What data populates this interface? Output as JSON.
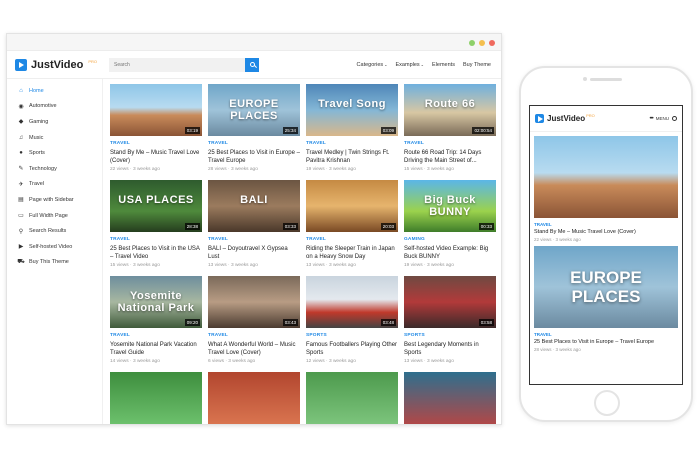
{
  "site": {
    "logo_text": "JustVideo",
    "logo_sup": "PRO",
    "search_placeholder": "Search"
  },
  "topnav": [
    {
      "label": "Categories",
      "caret": "⌄"
    },
    {
      "label": "Examples",
      "caret": "⌄"
    },
    {
      "label": "Elements",
      "caret": ""
    },
    {
      "label": "Buy Theme",
      "caret": ""
    }
  ],
  "sidebar": [
    {
      "label": "Home",
      "icon": "home-icon",
      "glyph": "⌂",
      "active": true
    },
    {
      "label": "Automotive",
      "icon": "car-icon",
      "glyph": "◉"
    },
    {
      "label": "Gaming",
      "icon": "gamepad-icon",
      "glyph": "◆"
    },
    {
      "label": "Music",
      "icon": "headphones-icon",
      "glyph": "♫"
    },
    {
      "label": "Sports",
      "icon": "ball-icon",
      "glyph": "●"
    },
    {
      "label": "Technology",
      "icon": "wrench-icon",
      "glyph": "✎"
    },
    {
      "label": "Travel",
      "icon": "plane-icon",
      "glyph": "✈"
    },
    {
      "label": "Page with Sidebar",
      "icon": "page-icon",
      "glyph": "▤"
    },
    {
      "label": "Full Width Page",
      "icon": "page-icon",
      "glyph": "▭"
    },
    {
      "label": "Search Results",
      "icon": "search-icon",
      "glyph": "⚲"
    },
    {
      "label": "Self-hosted Video",
      "icon": "video-icon",
      "glyph": "▶"
    },
    {
      "label": "Buy This Theme",
      "icon": "cart-icon",
      "glyph": "⛟"
    }
  ],
  "videos": [
    {
      "category": "TRAVEL",
      "title": "Stand By Me – Music Travel Love (Cover)",
      "views": "22 views",
      "age": "3 weeks ago",
      "duration": "03:19",
      "overlay": ""
    },
    {
      "category": "TRAVEL",
      "title": "25 Best Places to Visit in Europe – Travel Europe",
      "views": "28 views",
      "age": "3 weeks ago",
      "duration": "25:34",
      "overlay": "EUROPE PLACES"
    },
    {
      "category": "TRAVEL",
      "title": "Travel Medley | Twin Strings Ft. Pavitra Krishnan",
      "views": "19 views",
      "age": "3 weeks ago",
      "duration": "03:09",
      "overlay": "Travel Song"
    },
    {
      "category": "TRAVEL",
      "title": "Route 66 Road Trip: 14 Days Driving the Main Street of...",
      "views": "15 views",
      "age": "3 weeks ago",
      "duration": "02:00:54",
      "overlay": "Route 66"
    },
    {
      "category": "TRAVEL",
      "title": "25 Best Places to Visit in the USA – Travel Video",
      "views": "15 views",
      "age": "3 weeks ago",
      "duration": "28:38",
      "overlay": "USA PLACES"
    },
    {
      "category": "TRAVEL",
      "title": "BALI – Doyoutravel X Gypsea Lust",
      "views": "13 views",
      "age": "3 weeks ago",
      "duration": "03:33",
      "overlay": "BALI"
    },
    {
      "category": "TRAVEL",
      "title": "Riding the Sleeper Train in Japan on a Heavy Snow Day",
      "views": "13 views",
      "age": "3 weeks ago",
      "duration": "20:03",
      "overlay": ""
    },
    {
      "category": "GAMING",
      "title": "Self-hosted Video Example: Big Buck BUNNY",
      "views": "19 views",
      "age": "3 weeks ago",
      "duration": "00:33",
      "overlay": "Big Buck BUNNY"
    },
    {
      "category": "TRAVEL",
      "title": "Yosemite National Park Vacation Travel Guide",
      "views": "14 views",
      "age": "3 weeks ago",
      "duration": "09:20",
      "overlay": "Yosemite National Park"
    },
    {
      "category": "TRAVEL",
      "title": "What A Wonderful World – Music Travel Love (Cover)",
      "views": "6 views",
      "age": "3 weeks ago",
      "duration": "03:43",
      "overlay": ""
    },
    {
      "category": "SPORTS",
      "title": "Famous Footballers Playing Other Sports",
      "views": "12 views",
      "age": "3 weeks ago",
      "duration": "03:48",
      "overlay": ""
    },
    {
      "category": "SPORTS",
      "title": "Best Legendary Moments in Sports",
      "views": "13 views",
      "age": "3 weeks ago",
      "duration": "03:58",
      "overlay": ""
    },
    {
      "category": "",
      "title": "",
      "views": "",
      "age": "",
      "duration": "",
      "overlay": ""
    },
    {
      "category": "",
      "title": "",
      "views": "",
      "age": "",
      "duration": "",
      "overlay": ""
    },
    {
      "category": "",
      "title": "",
      "views": "",
      "age": "",
      "duration": "",
      "overlay": ""
    },
    {
      "category": "",
      "title": "",
      "views": "",
      "age": "",
      "duration": "",
      "overlay": ""
    }
  ],
  "mobile": {
    "menu_label": "MENU",
    "videos": [
      {
        "category": "TRAVEL",
        "title": "Stand By Me – Music Travel Love (Cover)",
        "meta": "22 views · 3 weeks ago",
        "overlay": ""
      },
      {
        "category": "TRAVEL",
        "title": "25 Best Places to Visit in Europe – Travel Europe",
        "meta": "28 views · 3 weeks ago",
        "overlay": "EUROPE PLACES"
      }
    ]
  },
  "colors": {
    "accent": "#1e88e5",
    "category": "#1e88e5",
    "meta": "#999999"
  }
}
